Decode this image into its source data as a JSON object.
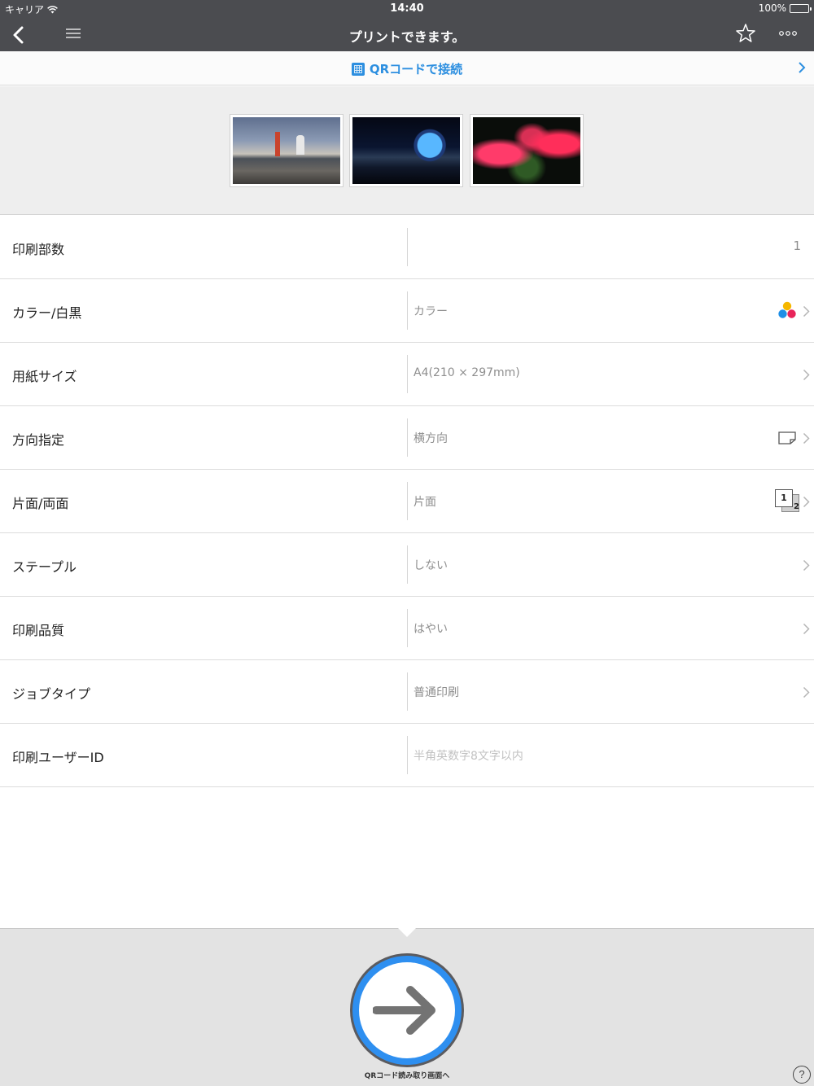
{
  "status": {
    "carrier": "キャリア",
    "time": "14:40",
    "battery": "100%"
  },
  "nav": {
    "title": "プリントできます。"
  },
  "qr_banner": {
    "label": "QRコードで接続"
  },
  "settings": {
    "copies": {
      "label": "印刷部数",
      "value": "1"
    },
    "color": {
      "label": "カラー/白黒",
      "value": "カラー"
    },
    "paper": {
      "label": "用紙サイズ",
      "value": "A4(210 × 297mm)"
    },
    "orientation": {
      "label": "方向指定",
      "value": "横方向"
    },
    "duplex": {
      "label": "片面/両面",
      "value": "片面",
      "icon_front": "1",
      "icon_back": "2"
    },
    "staple": {
      "label": "ステープル",
      "value": "しない"
    },
    "quality": {
      "label": "印刷品質",
      "value": "はやい"
    },
    "job_type": {
      "label": "ジョブタイプ",
      "value": "普通印刷"
    },
    "user_id": {
      "label": "印刷ユーザーID",
      "placeholder": "半角英数字8文字以内"
    }
  },
  "bottom": {
    "go_label": "QRコード読み取り画面へ",
    "help": "?"
  },
  "icons": {
    "back": "chevron-left-icon",
    "menu": "hamburger-menu-icon",
    "star": "star-icon",
    "more": "more-dots-icon",
    "qr": "qr-code-icon",
    "color_dots": "color-dots-icon",
    "landscape": "landscape-page-icon",
    "duplex": "duplex-pages-icon",
    "go": "arrow-right-icon",
    "help": "help-icon"
  },
  "colors": {
    "nav_bg": "#4b4c50",
    "accent": "#2e8ff0",
    "link": "#2d8fe0"
  }
}
